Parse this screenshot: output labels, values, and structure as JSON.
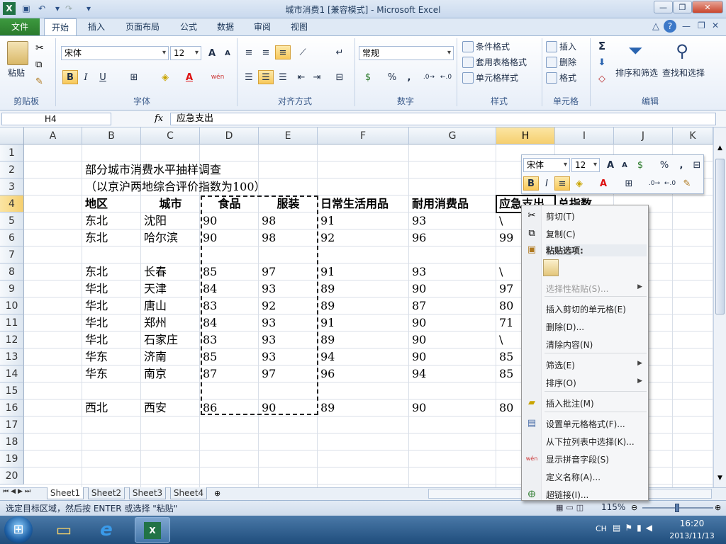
{
  "window": {
    "title": "城市消费1  [兼容模式]  -  Microsoft Excel"
  },
  "ribbon_tabs": {
    "file": "文件",
    "home": "开始",
    "insert": "插入",
    "layout": "页面布局",
    "formulas": "公式",
    "data": "数据",
    "review": "审阅",
    "view": "视图"
  },
  "clipboard": {
    "paste": "粘贴",
    "label": "剪贴板"
  },
  "font_group": {
    "font_name": "宋体",
    "font_size": "12",
    "label": "字体",
    "bold": "B",
    "italic": "I",
    "underline": "U",
    "grow": "A",
    "shrink": "A",
    "font_color": "A",
    "phonetic": "wén"
  },
  "align_group": {
    "label": "对齐方式"
  },
  "number_group": {
    "format": "常规",
    "label": "数字",
    "percent": "%",
    "comma": ","
  },
  "styles_group": {
    "cond_format": "条件格式",
    "table_format": "套用表格格式",
    "cell_styles": "单元格样式",
    "label": "样式"
  },
  "cells_group": {
    "insert": "插入",
    "delete": "删除",
    "format": "格式",
    "label": "单元格"
  },
  "edit_group": {
    "sort_filter": "排序和筛选",
    "find_select": "查找和选择",
    "label": "编辑",
    "sum": "Σ"
  },
  "formula_bar": {
    "name_box": "H4",
    "fx": "fx",
    "content": "应急支出"
  },
  "columns": [
    "A",
    "B",
    "C",
    "D",
    "E",
    "F",
    "G",
    "H",
    "I",
    "J",
    "K"
  ],
  "rows": [
    "1",
    "2",
    "3",
    "4",
    "5",
    "6",
    "7",
    "8",
    "9",
    "10",
    "11",
    "12",
    "13",
    "14",
    "15",
    "16",
    "17",
    "18",
    "19",
    "20"
  ],
  "sheet": {
    "title": "部分城市消费水平抽样调查",
    "subtitle": "（以京沪两地综合评价指数为100）",
    "headers": [
      "地区",
      "城市",
      "食品",
      "服装",
      "日常生活用品",
      "耐用消费品",
      "应急支出",
      "总指数"
    ],
    "data_rows": [
      {
        "row": 5,
        "cells": [
          "东北",
          "沈阳",
          "90",
          "98",
          "91",
          "93",
          "\\"
        ]
      },
      {
        "row": 6,
        "cells": [
          "东北",
          "哈尔滨",
          "90",
          "98",
          "92",
          "96",
          "99"
        ]
      },
      {
        "row": 8,
        "cells": [
          "东北",
          "长春",
          "85",
          "97",
          "91",
          "93",
          "\\"
        ]
      },
      {
        "row": 9,
        "cells": [
          "华北",
          "天津",
          "84",
          "93",
          "89",
          "90",
          "97"
        ]
      },
      {
        "row": 10,
        "cells": [
          "华北",
          "唐山",
          "83",
          "92",
          "89",
          "87",
          "80"
        ]
      },
      {
        "row": 11,
        "cells": [
          "华北",
          "郑州",
          "84",
          "93",
          "91",
          "90",
          "71"
        ]
      },
      {
        "row": 12,
        "cells": [
          "华北",
          "石家庄",
          "83",
          "93",
          "89",
          "90",
          "\\"
        ]
      },
      {
        "row": 13,
        "cells": [
          "华东",
          "济南",
          "85",
          "93",
          "94",
          "90",
          "85"
        ]
      },
      {
        "row": 14,
        "cells": [
          "华东",
          "南京",
          "87",
          "97",
          "96",
          "94",
          "85"
        ]
      },
      {
        "row": 16,
        "cells": [
          "西北",
          "西安",
          "86",
          "90",
          "89",
          "90",
          "80"
        ]
      }
    ]
  },
  "sheet_tabs": [
    "Sheet1",
    "Sheet2",
    "Sheet3",
    "Sheet4"
  ],
  "status": {
    "message": "选定目标区域，然后按 ENTER 或选择 \"粘贴\"",
    "zoom": "115%"
  },
  "mini_toolbar": {
    "font": "宋体",
    "size": "12",
    "percent": "%",
    "comma": ","
  },
  "context_menu": {
    "cut": "剪切(T)",
    "copy": "复制(C)",
    "paste_options": "粘贴选项:",
    "paste_special": "选择性粘贴(S)...",
    "insert_cut": "插入剪切的单元格(E)",
    "delete": "删除(D)...",
    "clear": "清除内容(N)",
    "filter": "筛选(E)",
    "sort": "排序(O)",
    "insert_comment": "插入批注(M)",
    "format_cells": "设置单元格格式(F)...",
    "pick_list": "从下拉列表中选择(K)...",
    "phonetic": "显示拼音字段(S)",
    "define_name": "定义名称(A)...",
    "hyperlink": "超链接(I)..."
  },
  "taskbar": {
    "lang": "CH",
    "time": "16:20",
    "date": "2013/11/13"
  }
}
